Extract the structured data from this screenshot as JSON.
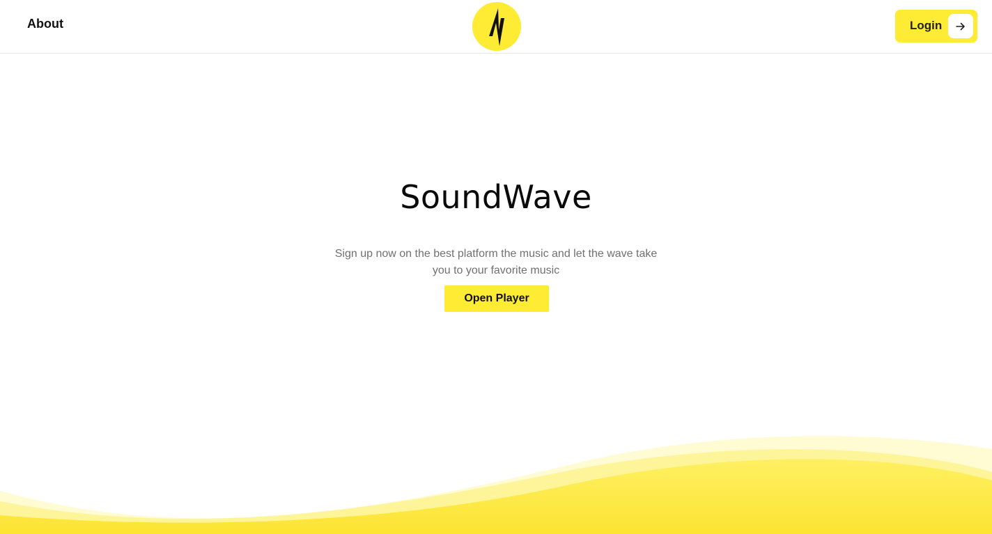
{
  "header": {
    "about_label": "About",
    "login_label": "Login"
  },
  "hero": {
    "title": "SoundWave",
    "subtitle": "Sign up now on the best platform the music and let the wave take you to your favorite music",
    "cta_label": "Open Player"
  },
  "icons": {
    "logo": "lightning-bolt-icon",
    "login_arrow": "arrow-right-icon"
  },
  "colors": {
    "accent": "#fdeb34",
    "text": "#111111",
    "muted": "#707070"
  }
}
